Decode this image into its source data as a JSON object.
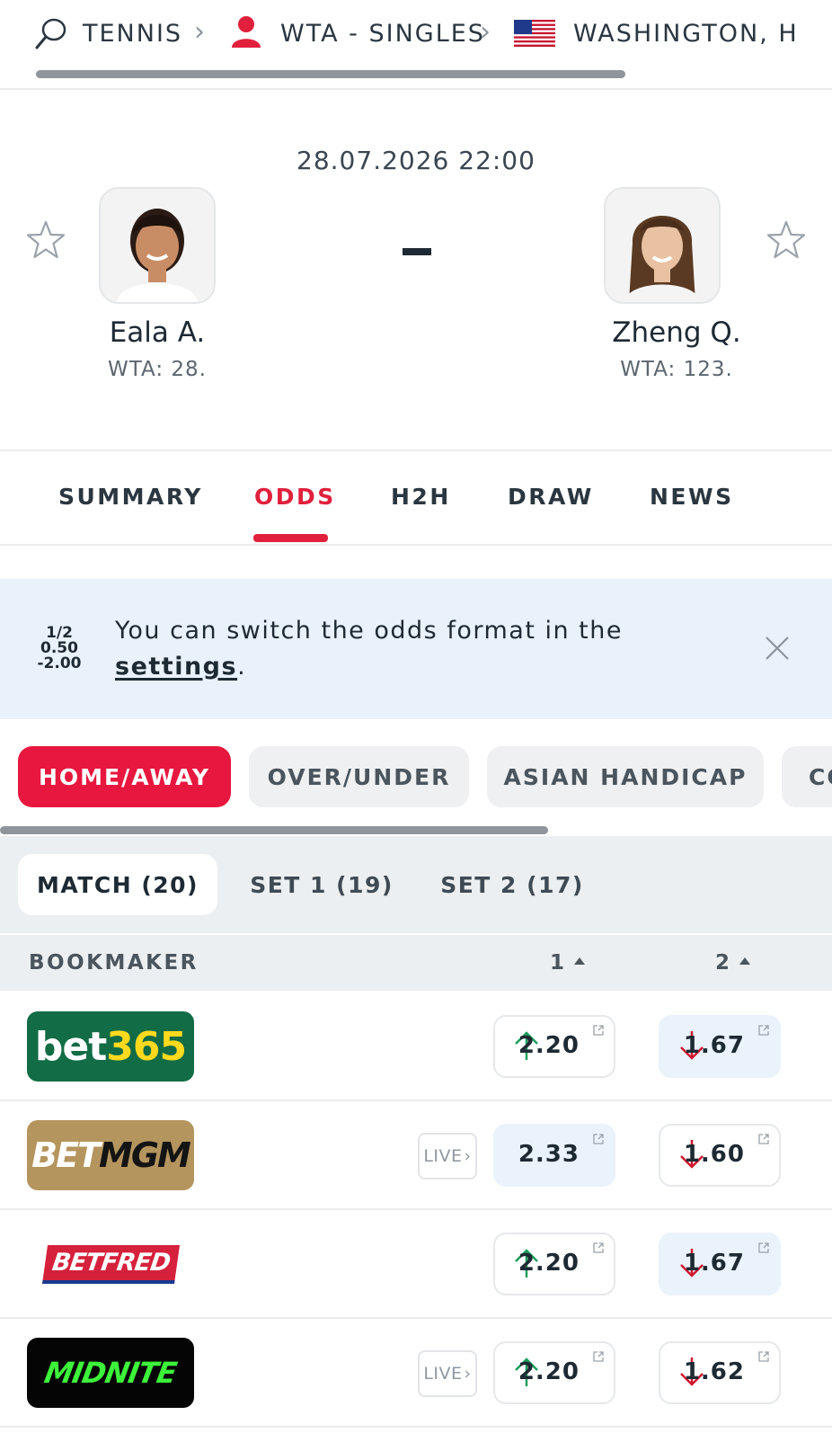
{
  "breadcrumb": {
    "sport": "TENNIS",
    "competition": "WTA - SINGLES",
    "tournament": "WASHINGTON, H"
  },
  "match": {
    "datetime": "28.07.2026 22:00",
    "score": "-",
    "home": {
      "name": "Eala A.",
      "rank": "WTA: 28."
    },
    "away": {
      "name": "Zheng Q.",
      "rank": "WTA: 123."
    }
  },
  "tabs": [
    "SUMMARY",
    "ODDS",
    "H2H",
    "DRAW",
    "NEWS"
  ],
  "active_tab": "ODDS",
  "banner": {
    "format_lines": [
      "1/2",
      "0.50",
      "-2.00"
    ],
    "text": "You can switch the odds format in the",
    "link": "settings",
    "after_link": "."
  },
  "bet_types": [
    "HOME/AWAY",
    "OVER/UNDER",
    "ASIAN HANDICAP",
    "CO"
  ],
  "periods": [
    "MATCH (20)",
    "SET 1 (19)",
    "SET 2 (17)"
  ],
  "table": {
    "headers": {
      "bookmaker": "BOOKMAKER",
      "col1": "1",
      "col2": "2"
    },
    "live_label": "LIVE",
    "rows": [
      {
        "bookmaker": "bet365",
        "logo_parts": [
          "bet",
          "365"
        ],
        "odd1": "2.20",
        "odd1_trend": "up",
        "odd2": "1.67",
        "odd2_trend": "down",
        "live": false
      },
      {
        "bookmaker": "BETMGM",
        "logo_parts": [
          "BET",
          "MGM"
        ],
        "odd1": "2.33",
        "odd1_trend": "none",
        "odd2": "1.60",
        "odd2_trend": "down",
        "live": true
      },
      {
        "bookmaker": "BETFRED",
        "logo_parts": [
          "BETFRED"
        ],
        "odd1": "2.20",
        "odd1_trend": "up",
        "odd2": "1.67",
        "odd2_trend": "down",
        "live": false
      },
      {
        "bookmaker": "MIDNITE",
        "logo_parts": [
          "MIDNITE"
        ],
        "odd1": "2.20",
        "odd1_trend": "up",
        "odd2": "1.62",
        "odd2_trend": "down",
        "live": true
      }
    ]
  },
  "colors": {
    "accent": "#e0203c",
    "odd_up": "#1a9e5c",
    "odd_down": "#d0182f",
    "highlight": "#eaf2fb"
  },
  "icons": {
    "sport": "tennis-racket-icon",
    "competition": "player-silhouette-icon",
    "country": "usa-flag-icon",
    "favorite": "star-outline-icon",
    "close": "close-icon",
    "external": "external-link-icon"
  }
}
